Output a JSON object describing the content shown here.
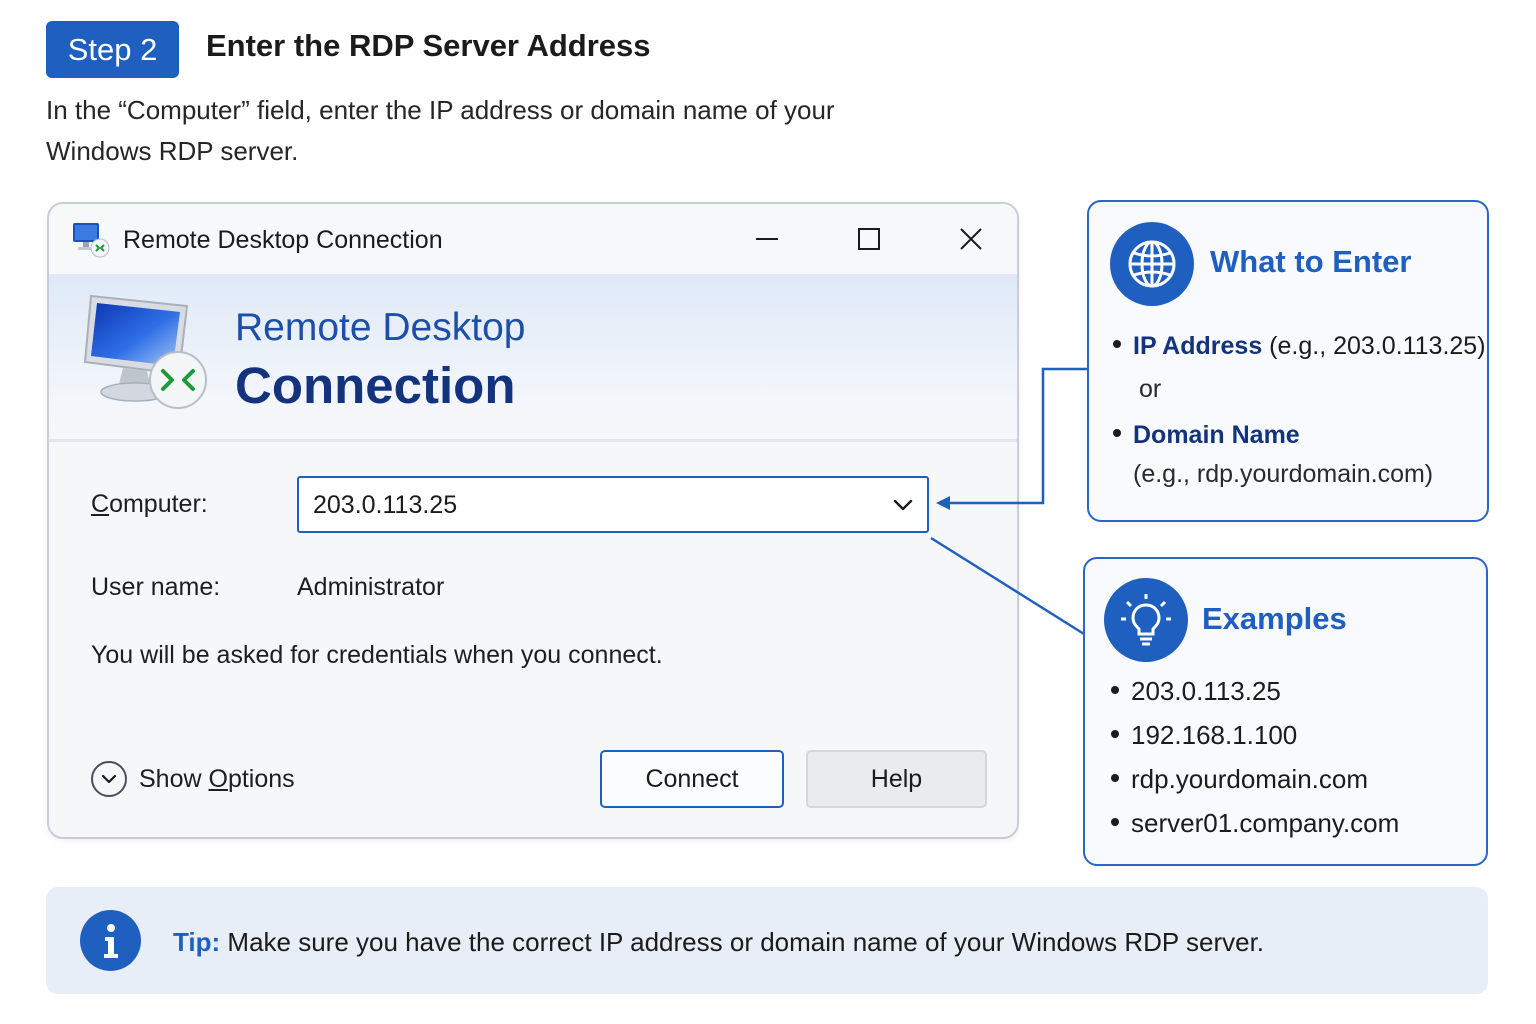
{
  "header": {
    "step_badge": "Step 2",
    "title": "Enter the RDP Server Address",
    "intro_line1": "In the “Computer” field, enter the IP address or domain name of your",
    "intro_line2": "Windows RDP server."
  },
  "dialog": {
    "window_title": "Remote Desktop Connection",
    "banner_line1": "Remote Desktop",
    "banner_line2": "Connection",
    "computer_label_key": "C",
    "computer_label_rest": "omputer:",
    "computer_value": "203.0.113.25",
    "username_label": "User name:",
    "username_value": "Administrator",
    "credentials_note": "You will be asked for credentials when you connect.",
    "show_options_prefix": "Show ",
    "show_options_key": "O",
    "show_options_rest": "ptions",
    "connect_label": "Connect",
    "help_label": "Help"
  },
  "what_to_enter": {
    "title": "What to Enter",
    "ip_label": "IP Address",
    "ip_example": " (e.g., 203.0.113.25)",
    "or": "or",
    "domain_label": "Domain Name",
    "domain_example": "(e.g., rdp.yourdomain.com)",
    "icon": "globe-icon"
  },
  "examples": {
    "title": "Examples",
    "items": [
      "203.0.113.25",
      "192.168.1.100",
      "rdp.yourdomain.com",
      "server01.company.com"
    ],
    "icon": "lightbulb-icon"
  },
  "tip": {
    "label": "Tip:",
    "text": " Make sure you have the correct IP address or domain name of your Windows RDP server.",
    "icon": "info-icon"
  },
  "colors": {
    "accent": "#1f5fc0",
    "navy": "#13347d",
    "tip_bg": "#e8eef8"
  }
}
